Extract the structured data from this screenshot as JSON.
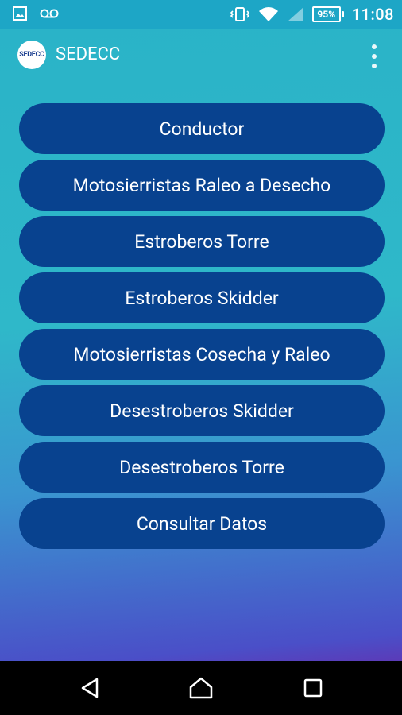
{
  "status_bar": {
    "battery_percent": "95%",
    "time": "11:08",
    "icons": [
      "image-icon",
      "voicemail-icon",
      "vibrate-icon",
      "wifi-icon",
      "signal-icon",
      "battery-icon"
    ]
  },
  "app_bar": {
    "logo_text": "SEDECC",
    "title": "SEDECC",
    "overflow_icon": "more-vert-icon"
  },
  "menu": {
    "items": [
      {
        "label": "Conductor"
      },
      {
        "label": "Motosierristas Raleo a Desecho"
      },
      {
        "label": "Estroberos Torre"
      },
      {
        "label": "Estroberos Skidder"
      },
      {
        "label": "Motosierristas Cosecha y Raleo"
      },
      {
        "label": "Desestroberos Skidder"
      },
      {
        "label": "Desestroberos Torre"
      },
      {
        "label": "Consultar Datos"
      }
    ]
  },
  "nav_bar": {
    "icons": [
      "back-icon",
      "home-icon",
      "recents-icon"
    ]
  },
  "colors": {
    "status_bar": "#1da6c6",
    "button_bg": "#08428f",
    "gradient_top": "#2ab3c8",
    "gradient_bottom": "#5b3bb8"
  }
}
